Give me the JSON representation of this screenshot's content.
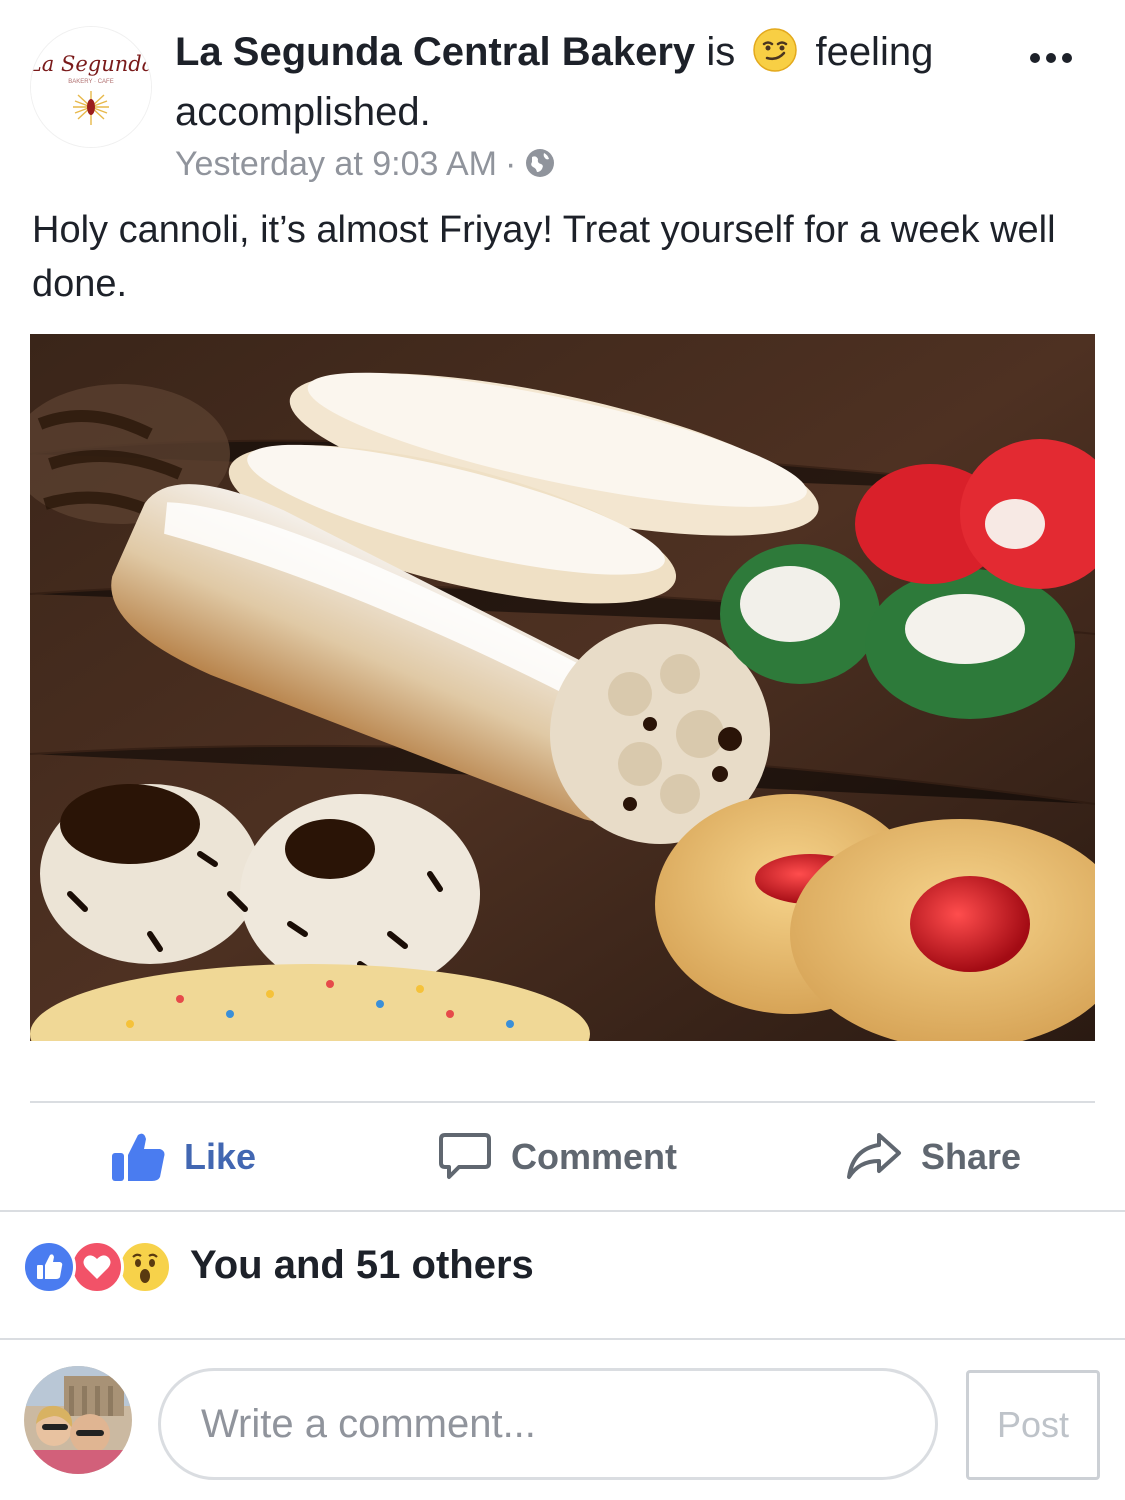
{
  "post": {
    "page_name": "La Segunda Central Bakery",
    "is_word": "is",
    "feeling": "feeling",
    "feeling_detail": "accomplished.",
    "page_logo_text": "La Segunda",
    "page_logo_subtext": "BAKERY · CAFE",
    "timestamp": "Yesterday at 9:03 AM",
    "timestamp_separator": "·",
    "privacy_icon": "globe-icon",
    "feeling_icon": "smirk-emoji-icon",
    "text": "Holy cannoli, it’s almost Friyay! Treat yourself for a week well done.",
    "more_icon": "ellipsis-icon"
  },
  "actions": {
    "like_label": "Like",
    "like_icon": "thumbs-up-icon",
    "comment_label": "Comment",
    "comment_icon": "speech-bubble-icon",
    "share_label": "Share",
    "share_icon": "share-arrow-icon"
  },
  "reactions": {
    "icons": [
      "like-reaction-icon",
      "love-reaction-icon",
      "wow-reaction-icon"
    ],
    "summary": "You and 51 others"
  },
  "composer": {
    "placeholder": "Write a comment...",
    "post_label": "Post"
  },
  "colors": {
    "facebook_blue": "#4267b2",
    "text_primary": "#1d2129",
    "text_secondary": "#90949c",
    "like_reaction": "#4a7cf0",
    "love_reaction": "#f25268",
    "wow_reaction": "#f7d24a"
  }
}
